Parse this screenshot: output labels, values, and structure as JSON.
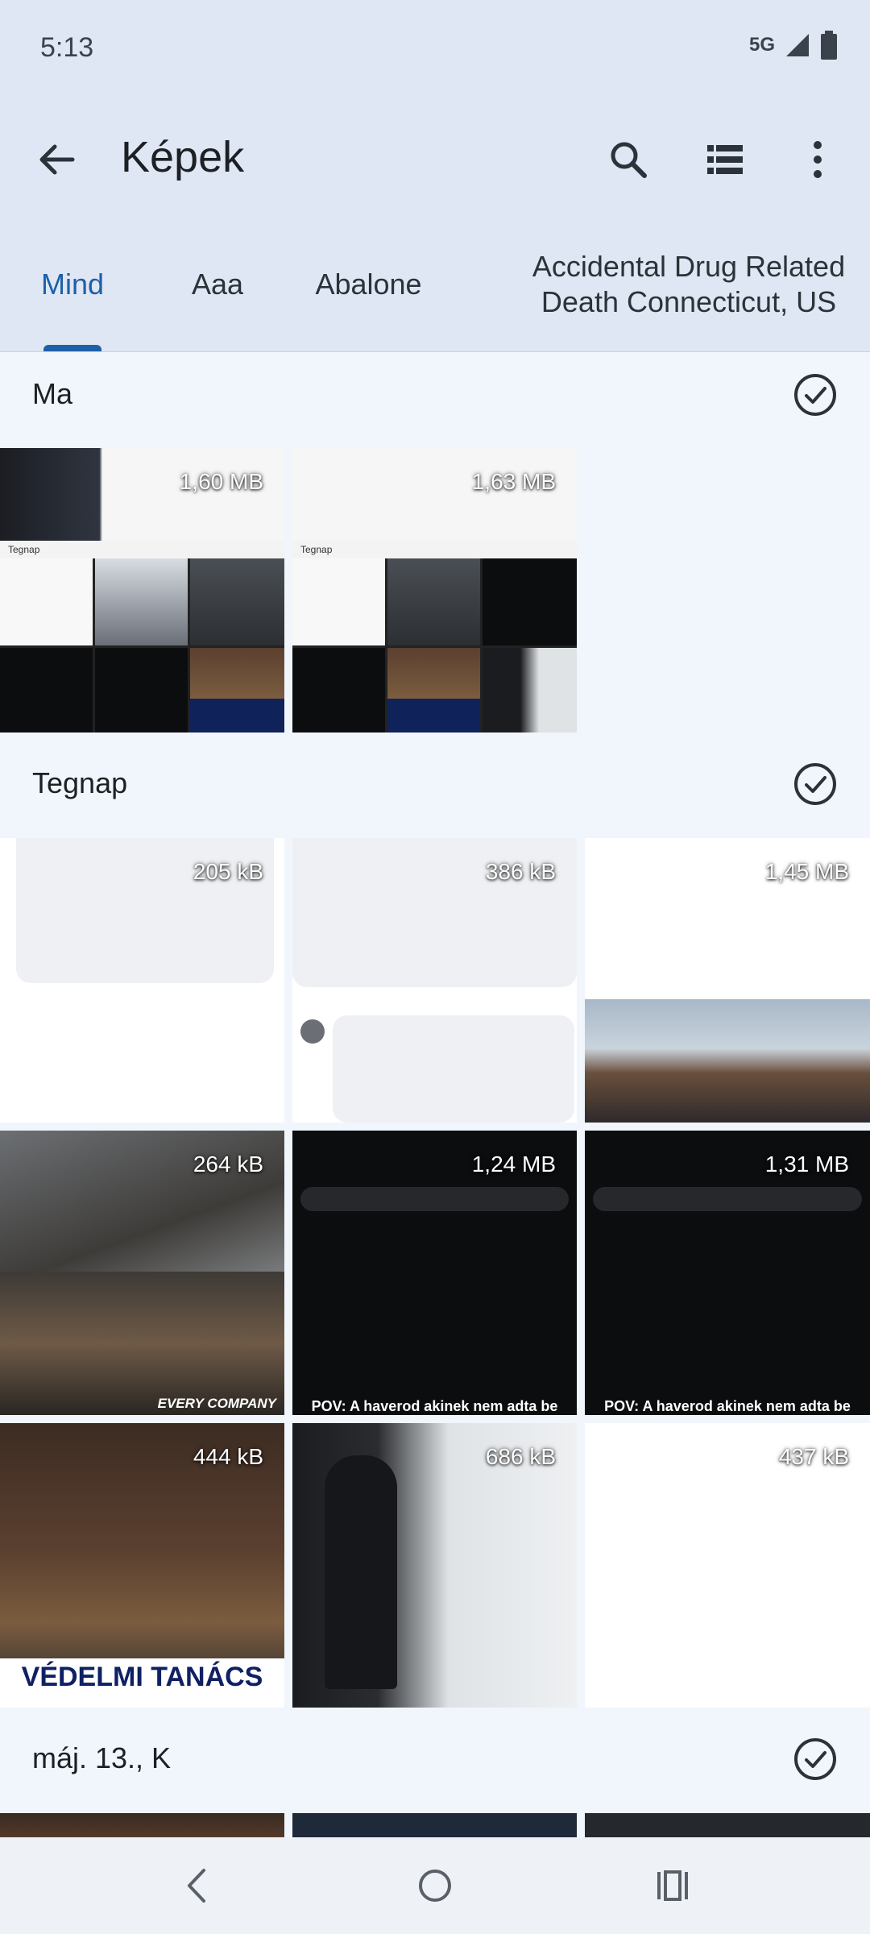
{
  "status_bar": {
    "time": "5:13",
    "network": "5G"
  },
  "app_bar": {
    "title": "Képek",
    "back_icon": "arrow-back-icon",
    "actions": [
      {
        "name": "search-icon"
      },
      {
        "name": "list-view-icon"
      },
      {
        "name": "more-vert-icon"
      }
    ]
  },
  "tabs": [
    {
      "label": "Mind",
      "active": true
    },
    {
      "label": "Aaa",
      "active": false
    },
    {
      "label": "Abalone",
      "active": false
    },
    {
      "label": "Accidental Drug Related Death Connecticut, US",
      "active": false
    }
  ],
  "sections": [
    {
      "label": "Ma",
      "items": [
        {
          "size": "1,60 MB",
          "caption": "Tegnap"
        },
        {
          "size": "1,63 MB",
          "caption": "Tegnap"
        }
      ]
    },
    {
      "label": "Tegnap",
      "items": [
        {
          "size": "205 kB"
        },
        {
          "size": "386 kB"
        },
        {
          "size": "1,45 MB"
        },
        {
          "size": "264 kB",
          "caption": "EVERY COMPANY"
        },
        {
          "size": "1,24 MB",
          "caption": "POV: A haverod akinek nem adta be"
        },
        {
          "size": "1,31 MB",
          "caption": "POV: A haverod akinek nem adta be"
        },
        {
          "size": "444 kB",
          "caption": "VÉDELMI TANÁCS"
        },
        {
          "size": "686 kB"
        },
        {
          "size": "437 kB"
        }
      ]
    },
    {
      "label": "máj. 13., K"
    }
  ],
  "colors": {
    "accent": "#1f5fa8",
    "header_bg": "#dee7f3",
    "page_bg": "#f1f6fc"
  }
}
